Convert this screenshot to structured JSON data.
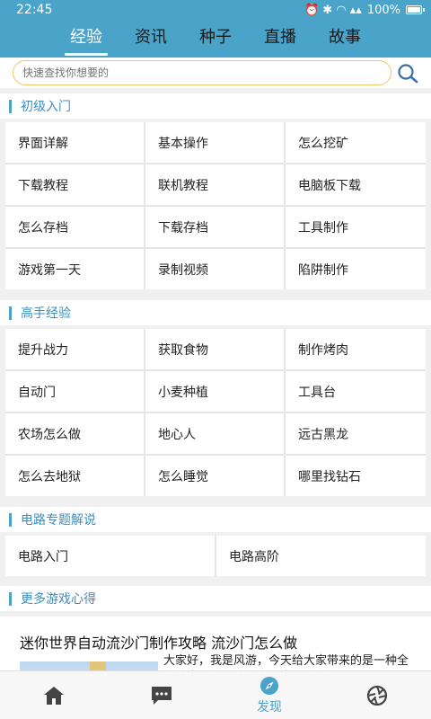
{
  "status_bar": {
    "time": "22:45",
    "icons": "⏰ ✱ ◠ ▴▴ ",
    "battery": "100%"
  },
  "top_tabs": [
    {
      "label": "经验",
      "active": true
    },
    {
      "label": "资讯",
      "active": false
    },
    {
      "label": "种子",
      "active": false
    },
    {
      "label": "直播",
      "active": false
    },
    {
      "label": "故事",
      "active": false
    }
  ],
  "search": {
    "placeholder": "快速查找你想要的",
    "icon": "search-icon"
  },
  "sections": [
    {
      "title": "初级入门",
      "items": [
        "界面详解",
        "基本操作",
        "怎么挖矿",
        "下载教程",
        "联机教程",
        "电脑板下载",
        "怎么存档",
        "下载存档",
        "工具制作",
        "游戏第一天",
        "录制视频",
        "陷阱制作"
      ]
    },
    {
      "title": "高手经验",
      "items": [
        "提升战力",
        "获取食物",
        "制作烤肉",
        "自动门",
        "小麦种植",
        "工具台",
        "农场怎么做",
        "地心人",
        "远古黑龙",
        "怎么去地狱",
        "怎么睡觉",
        "哪里找钻石"
      ]
    },
    {
      "title": "电路专题解说",
      "items": [
        "电路入门",
        "电路高阶"
      ]
    },
    {
      "title": "更多游戏心得",
      "items": []
    }
  ],
  "article": {
    "title": "迷你世界自动流沙门制作攻略 流沙门怎么做",
    "excerpt": "大家好，我是风游，今天给大家带来的是一种全新的自动门，迷你世界自动流沙门，具"
  },
  "bottom_nav": [
    {
      "icon": "home-icon",
      "label": ""
    },
    {
      "icon": "chat-icon",
      "label": ""
    },
    {
      "icon": "compass-icon",
      "label": "发现"
    },
    {
      "icon": "aperture-icon",
      "label": ""
    }
  ],
  "colors": {
    "primary": "#4aa3c8",
    "search_border": "#f2c46a",
    "section_title": "#3b8fbf"
  }
}
